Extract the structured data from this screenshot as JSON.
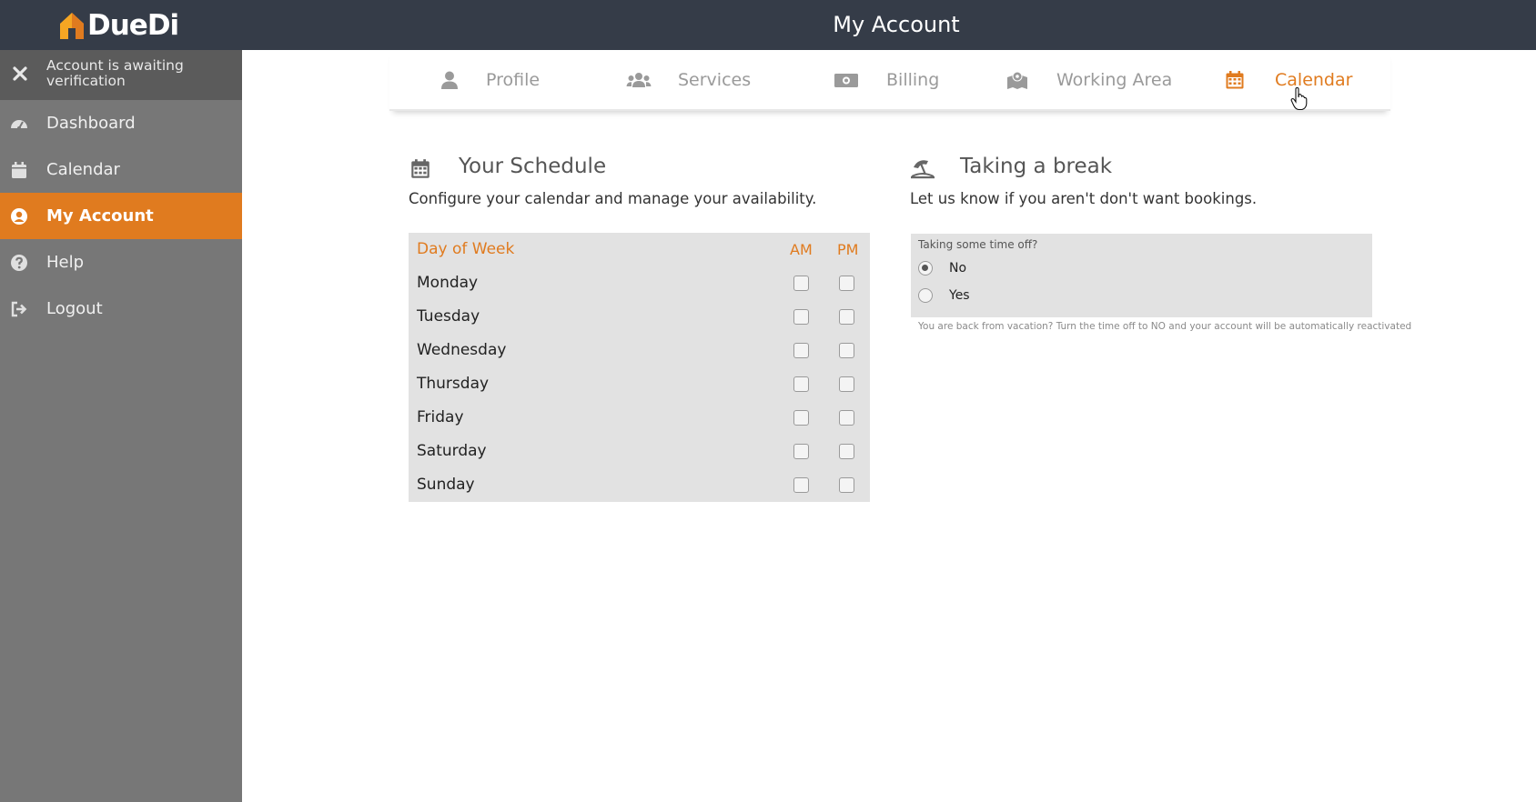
{
  "brand": {
    "name": "DueDi",
    "accent": "#e07b1f",
    "topbar_bg": "#353c48"
  },
  "header": {
    "title": "My Account"
  },
  "sidebar": {
    "notice": {
      "icon": "close-icon",
      "text": "Account is awaiting verification"
    },
    "items": [
      {
        "icon": "dashboard-icon",
        "label": "Dashboard",
        "active": false
      },
      {
        "icon": "calendar-icon",
        "label": "Calendar",
        "active": false
      },
      {
        "icon": "user-circle-icon",
        "label": "My Account",
        "active": true
      },
      {
        "icon": "help-icon",
        "label": "Help",
        "active": false
      },
      {
        "icon": "logout-icon",
        "label": "Logout",
        "active": false
      }
    ]
  },
  "tabs": [
    {
      "icon": "user-icon",
      "label": "Profile",
      "active": false
    },
    {
      "icon": "users-icon",
      "label": "Services",
      "active": false
    },
    {
      "icon": "money-icon",
      "label": "Billing",
      "active": false
    },
    {
      "icon": "map-icon",
      "label": "Working Area",
      "active": false
    },
    {
      "icon": "calendar-icon",
      "label": "Calendar",
      "active": true
    }
  ],
  "schedule": {
    "title": "Your Schedule",
    "subtitle": "Configure your calendar and manage your availability.",
    "columns": {
      "day": "Day of Week",
      "am": "AM",
      "pm": "PM"
    },
    "days": [
      {
        "name": "Monday",
        "am": false,
        "pm": false
      },
      {
        "name": "Tuesday",
        "am": false,
        "pm": false
      },
      {
        "name": "Wednesday",
        "am": false,
        "pm": false
      },
      {
        "name": "Thursday",
        "am": false,
        "pm": false
      },
      {
        "name": "Friday",
        "am": false,
        "pm": false
      },
      {
        "name": "Saturday",
        "am": false,
        "pm": false
      },
      {
        "name": "Sunday",
        "am": false,
        "pm": false
      }
    ]
  },
  "break": {
    "title": "Taking a break",
    "subtitle": "Let us know if you aren't don't want bookings.",
    "question": "Taking some time off?",
    "options": [
      {
        "label": "No",
        "selected": true
      },
      {
        "label": "Yes",
        "selected": false
      }
    ],
    "note": "You are back from vacation? Turn the time off to NO and your account will be automatically reactivated"
  }
}
